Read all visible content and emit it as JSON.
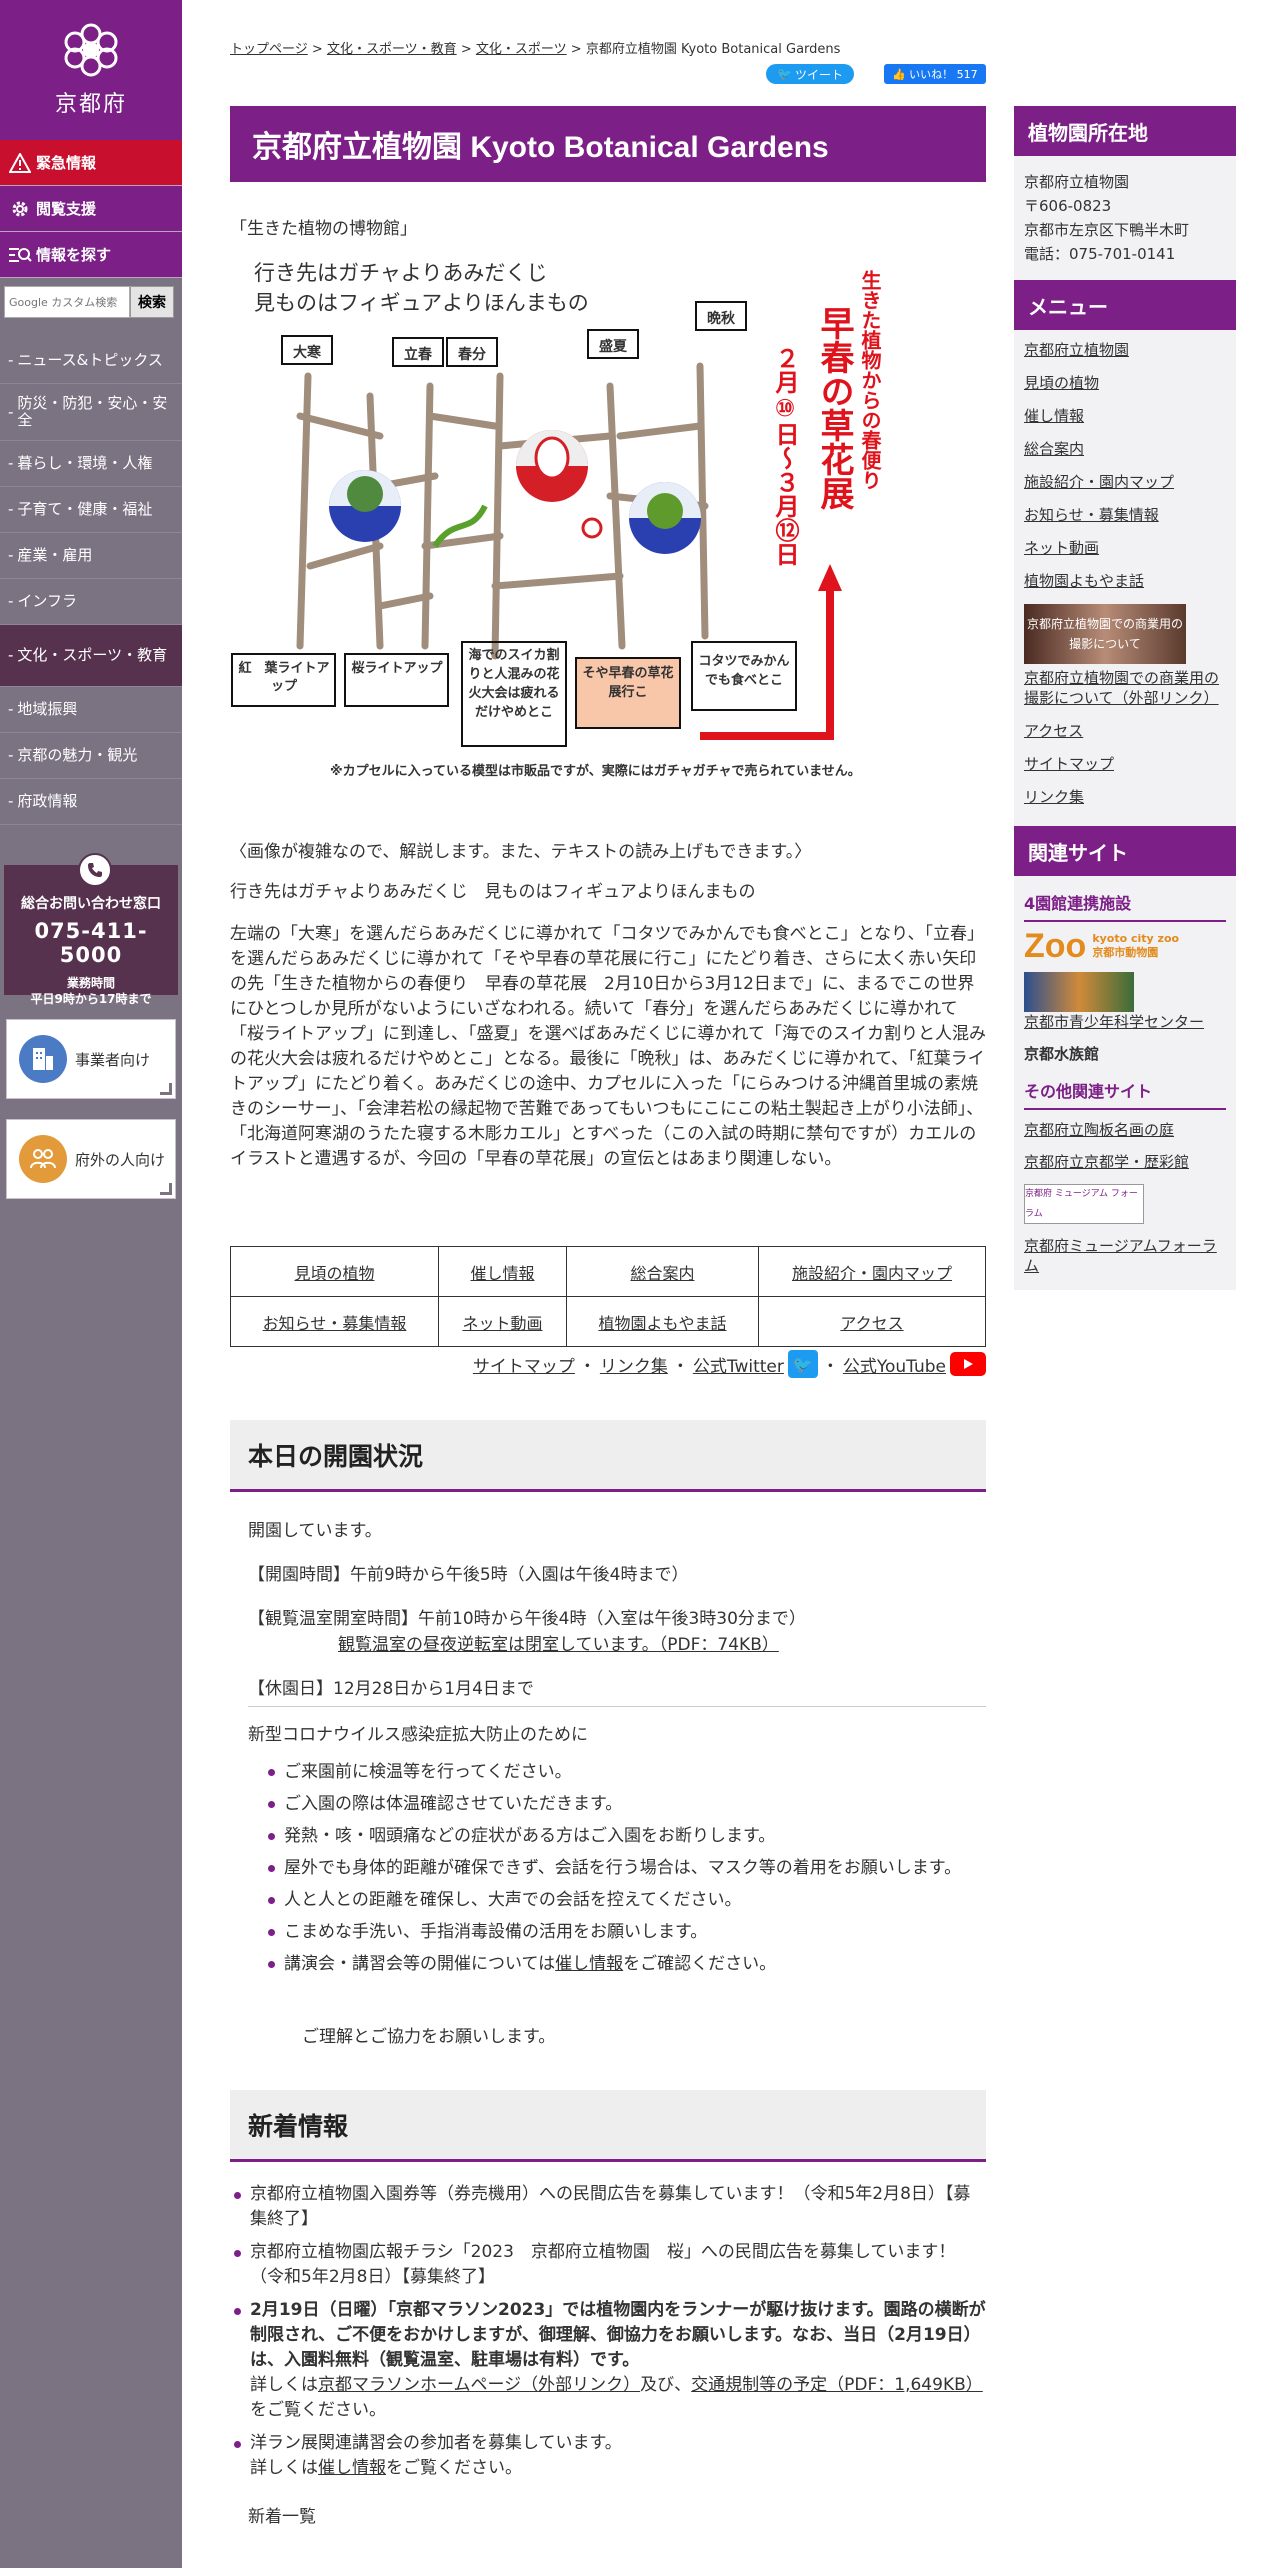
{
  "sidebar": {
    "logo_text": "京都府",
    "emergency": "緊急情報",
    "accessibility": "閲覧支援",
    "find_info": "情報を探す",
    "search_placeholder": "Google カスタム検索",
    "search_button": "検索",
    "nav": [
      "ニュース&トピックス",
      "防災・防犯・安心・安全",
      "暮らし・環境・人権",
      "子育て・健康・福祉",
      "産業・雇用",
      "インフラ",
      "文化・スポーツ・教育",
      "地域振興",
      "京都の魅力・観光",
      "府政情報"
    ],
    "contact_title": "総合お問い合わせ窓口",
    "contact_phone": "075-411-5000",
    "contact_hours_1": "業務時間",
    "contact_hours_2": "平日9時から17時まで",
    "business_btn": "事業者向け",
    "outside_btn": "府外の人向け"
  },
  "breadcrumb": {
    "items": [
      "トップページ",
      "文化・スポーツ・教育",
      "文化・スポーツ"
    ],
    "current": "京都府立植物園 Kyoto Botanical Gardens",
    "sep": ">"
  },
  "share": {
    "tweet": "ツイート",
    "like": "いいね！ 517"
  },
  "page": {
    "title": "京都府立植物園 Kyoto Botanical Gardens",
    "intro": "「生きた植物の博物館」"
  },
  "poster": {
    "line1": "行き先はガチャよりあみだくじ",
    "line2": "見ものはフィギュアよりほんまもの",
    "labels": [
      "大寒",
      "立春",
      "春分",
      "盛夏",
      "晩秋"
    ],
    "vertical_a": "生きた植物からの春便り",
    "vertical_b": "早春の草花展",
    "vertical_c": "２月⑩日～３月⑫日",
    "box1": "紅　葉ライトアップ",
    "box2": "桜ライトアップ",
    "box3": "海でのスイカ割りと人混みの花火大会は疲れるだけやめとこ",
    "box4": "そや早春の草花展行こ",
    "box5": "コタツでみかんでも食べとこ",
    "caption": "※カプセルに入っている模型は市販品ですが、実際にはガチャガチャで売られていません。"
  },
  "explain": {
    "note": "〈画像が複雑なので、解説します。また、テキストの読み上げもできます。〉",
    "line": "行き先はガチャよりあみだくじ　見ものはフィギュアよりほんまもの",
    "body": "左端の「大寒」を選んだらあみだくじに導かれて「コタツでみかんでも食べとこ」となり、「立春」を選んだらあみだくじに導かれて「そや早春の草花展に行こ」にたどり着き、さらに太く赤い矢印の先「生きた植物からの春便り　早春の草花展　2月10日から3月12日まで」に、まるでこの世界にひとつしか見所がないようにいざなわれる。続いて「春分」を選んだらあみだくじに導かれて「桜ライトアップ」に到達し、「盛夏」を選べばあみだくじに導かれて「海でのスイカ割りと人混みの花火大会は疲れるだけやめとこ」となる。最後に「晩秋」は、あみだくじに導かれて、「紅葉ライトアップ」にたどり着く。あみだくじの途中、カプセルに入った「にらみつける沖縄首里城の素焼きのシーサー」、「会津若松の縁起物で苦難であってもいつもにこにこの粘土製起き上がり小法師」、「北海道阿寒湖のうたた寝する木彫カエル」とすべった（この入試の時期に禁句ですが）カエルのイラストと遭遇するが、今回の「早春の草花展」の宣伝とはあまり関連しない。"
  },
  "links_table": [
    [
      "見頃の植物",
      "催し情報",
      "総合案内",
      "施設紹介・園内マップ"
    ],
    [
      "お知らせ・募集情報",
      "ネット動画",
      "植物園よもやま話",
      "アクセス"
    ]
  ],
  "sitemap": {
    "sitemap": "サイトマップ",
    "links": "リンク集",
    "twitter": "公式Twitter",
    "youtube": "公式YouTube",
    "dot": "・"
  },
  "status": {
    "heading": "本日の開園状況",
    "open": "開園しています。",
    "hours": "【開園時間】午前9時から午後5時（入園は午後4時まで）",
    "greenhouse": "【観覧温室開室時間】午前10時から午後4時（入室は午後3時30分まで）",
    "greenhouse_link": "観覧温室の昼夜逆転室は閉室しています。（PDF：74KB）",
    "closed": "【休園日】12月28日から1月4日まで",
    "covid_title": "新型コロナウイルス感染症拡大防止のために",
    "covid": [
      "ご来園前に検温等を行ってください。",
      "ご入園の際は体温確認させていただきます。",
      "発熱・咳・咽頭痛などの症状がある方はご入園をお断りします。",
      "屋外でも身体的距離が確保できず、会話を行う場合は、マスク等の着用をお願いします。",
      "人と人との距離を確保し、大声での会話を控えてください。",
      "こまめな手洗い、手指消毒設備の活用をお願いします。"
    ],
    "covid_last_pre": "講演会・講習会等の開催については",
    "covid_last_link": "催し情報",
    "covid_last_post": "をご確認ください。",
    "thanks": "ご理解とご協力をお願いします。"
  },
  "news": {
    "heading": "新着情報",
    "item1": "京都府立植物園入園券等（券売機用）への民間広告を募集しています！（令和5年2月8日）【募集終了】",
    "item2": "京都府立植物園広報チラシ「2023　京都府立植物園　桜」への民間広告を募集しています！（令和5年2月8日）【募集終了】",
    "item3_bold": "2月19日（日曜）「京都マラソン2023」では植物園内をランナーが駆け抜けます。園路の横断が制限され、ご不便をおかけしますが、御理解、御協力をお願いします。なお、当日（2月19日）は、入園料無料（観覧温室、駐車場は有料）です。",
    "item3_pre": "詳しくは",
    "item3_link1": "京都マラソンホームページ（外部リンク）",
    "item3_mid": "及び、",
    "item3_link2": "交通規制等の予定（PDF：1,649KB）",
    "item3_post": "をご覧ください。",
    "item4_line1": "洋ラン展関連講習会の参加者を募集しています。",
    "item4_pre": "詳しくは",
    "item4_link": "催し情報",
    "item4_post": "をご覧ください。",
    "more": "新着一覧"
  },
  "right": {
    "location_head": "植物園所在地",
    "addr": [
      "京都府立植物園",
      "〒606-0823",
      "京都市左京区下鴨半木町",
      "電話：075-701-0141"
    ],
    "menu_head": "メニュー",
    "menu": [
      "京都府立植物園",
      "見頃の植物",
      "催し情報",
      "総合案内",
      "施設紹介・園内マップ",
      "お知らせ・募集情報",
      "ネット動画",
      "植物園よもやま話"
    ],
    "banner_text": "京都府立植物園での商業用の撮影について",
    "banner_link": "京都府立植物園での商業用の撮影について（外部リンク）",
    "menu2": [
      "アクセス",
      "サイトマップ",
      "リンク集"
    ],
    "related_head": "関連サイト",
    "partner_title": "4園館連携施設",
    "zoo_text": "kyoto city zoo",
    "zoo_text2": "京都市動物園",
    "youth_link": "京都市青少年科学センター",
    "aquarium": "京都水族館",
    "other_title": "その他関連サイト",
    "other": [
      "京都府立陶板名画の庭",
      "京都府立京都学・歴彩館"
    ],
    "museum_banner": "京都府 ミュージアム フォーラム",
    "museum_link": "京都府ミュージアムフォーラム"
  },
  "colors": {
    "brand_purple": "#7c1f87",
    "emergency_red": "#c8102e",
    "sidebar_gray": "#7b7282"
  }
}
